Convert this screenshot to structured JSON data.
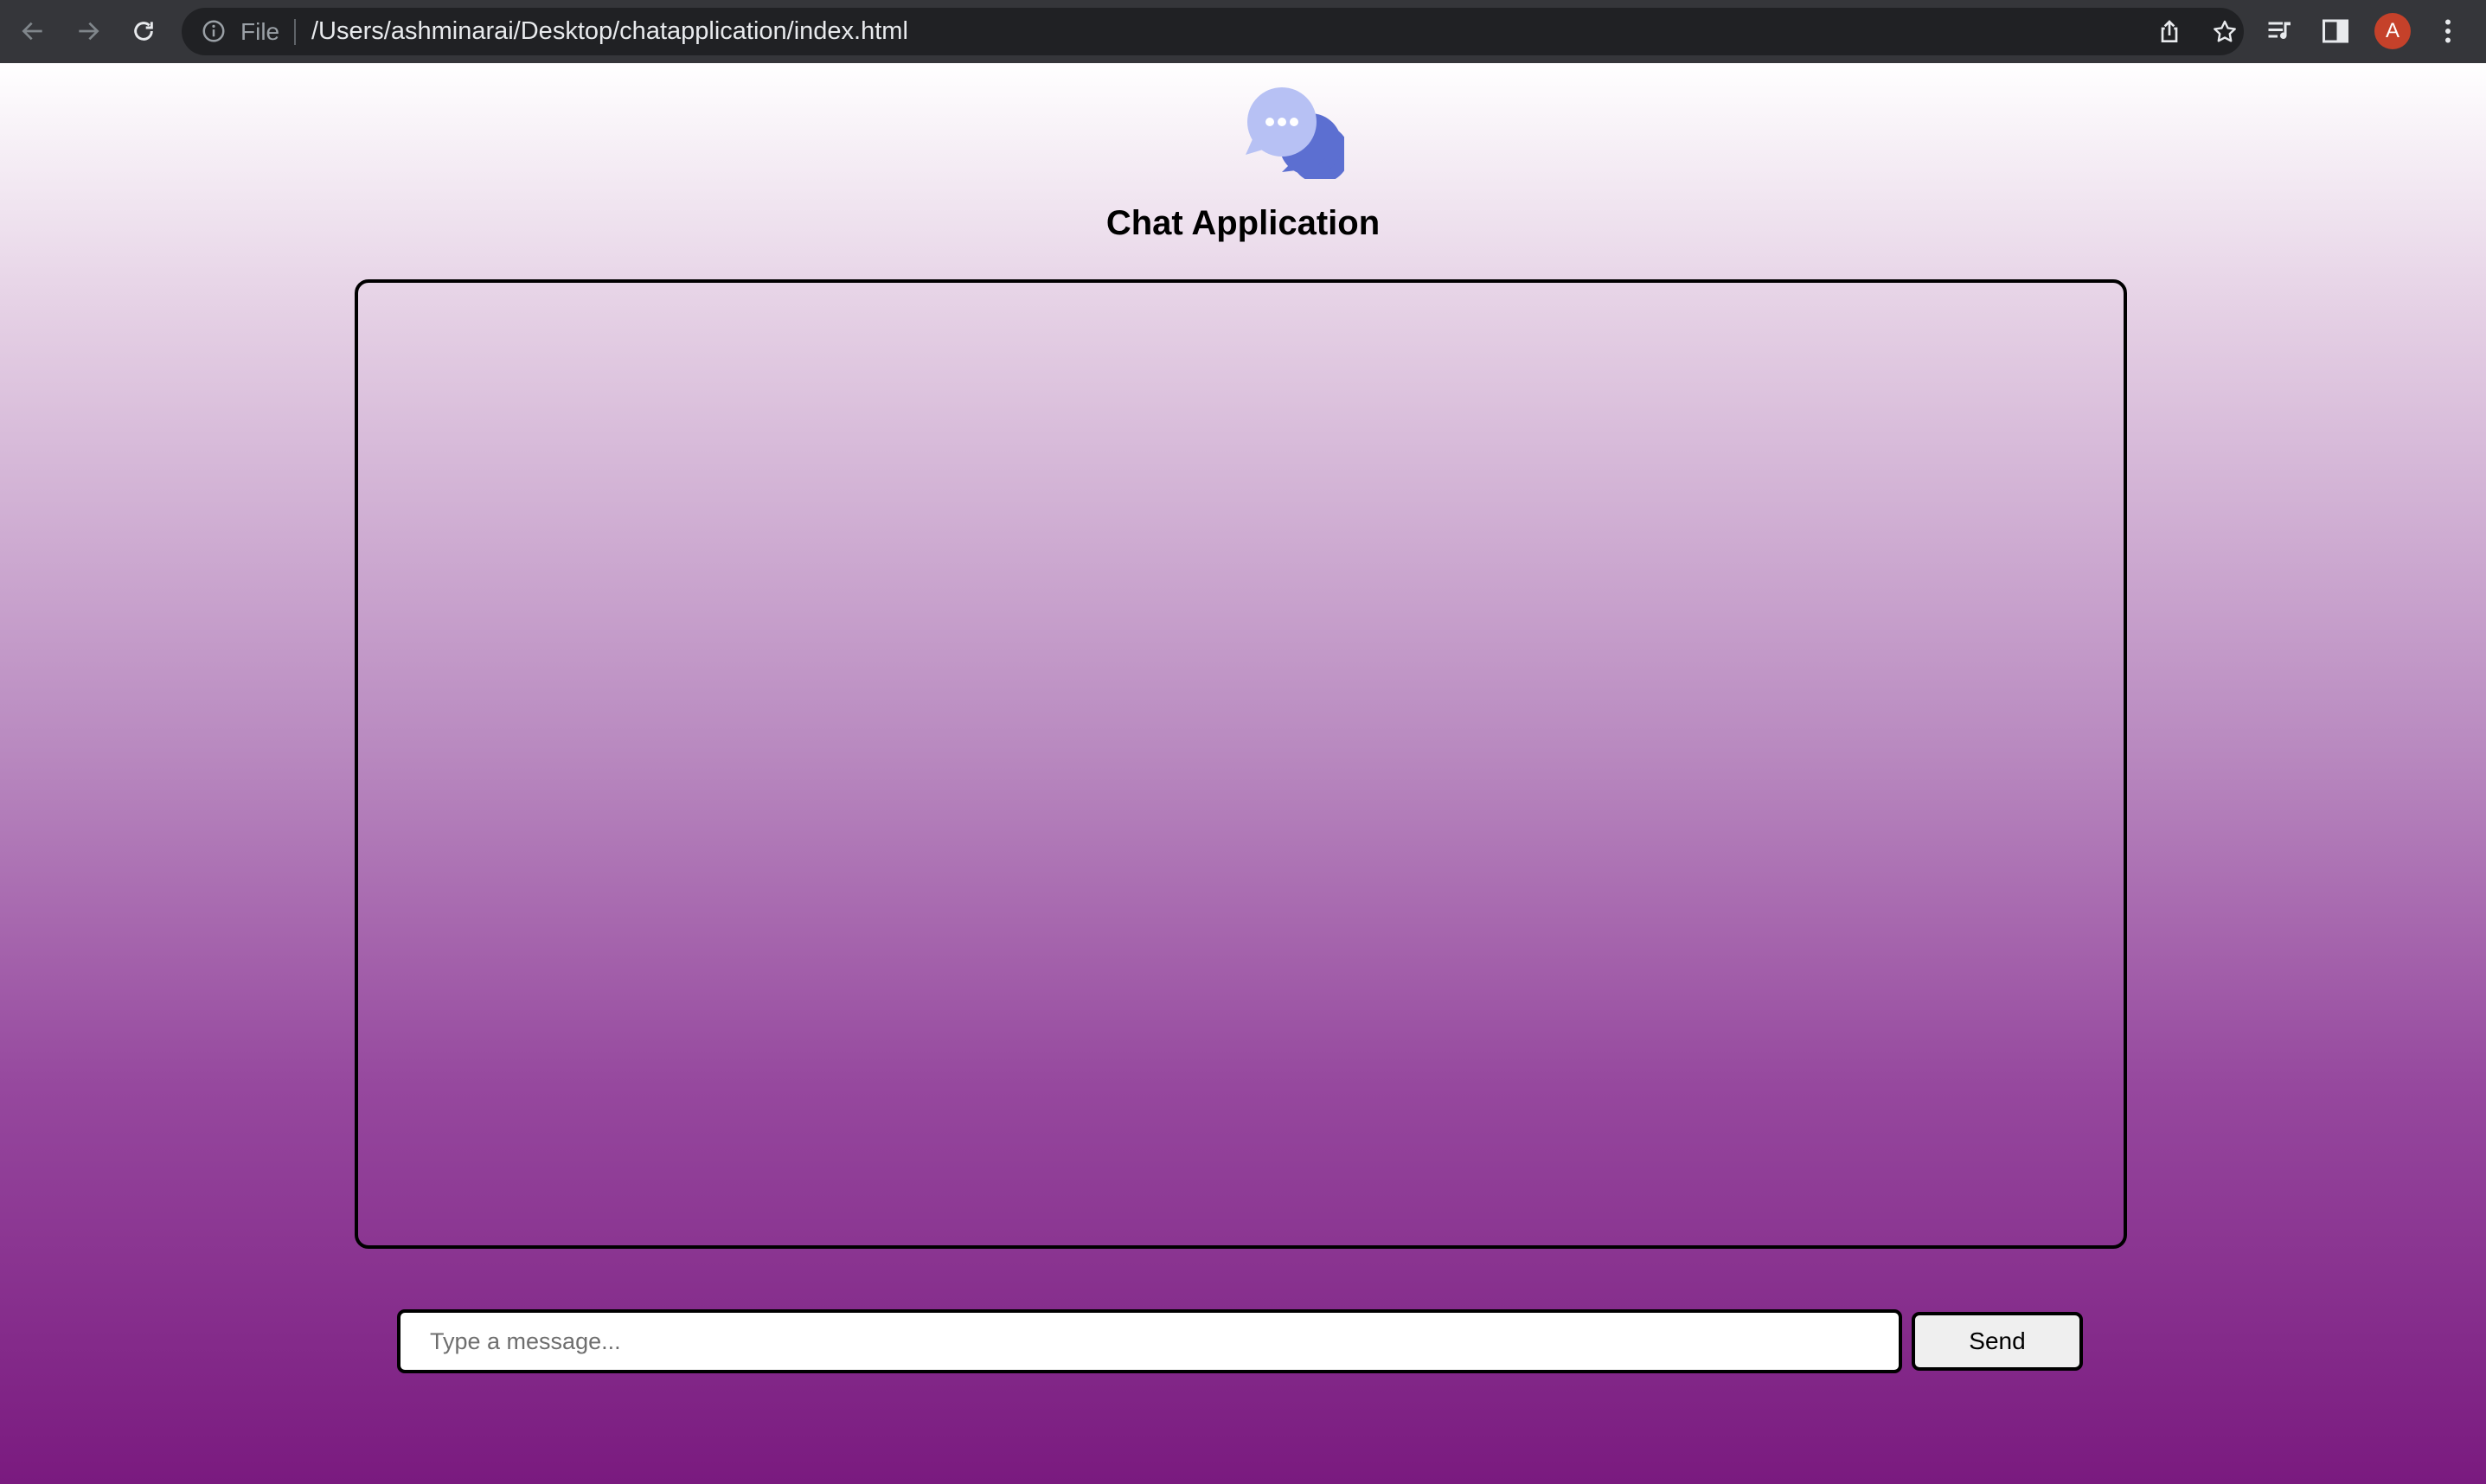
{
  "browser": {
    "nav": {
      "back_icon": "arrow-left-icon",
      "forward_icon": "arrow-right-icon",
      "reload_icon": "reload-icon"
    },
    "omnibox": {
      "info_icon": "info-circle-icon",
      "scheme_label": "File",
      "url": "/Users/ashminarai/Desktop/chatapplication/index.html",
      "share_icon": "share-icon",
      "bookmark_icon": "star-icon"
    },
    "toolbar": {
      "media_icon": "media-queue-icon",
      "side_panel_icon": "side-panel-icon",
      "profile_initial": "A",
      "menu_icon": "kebab-menu-icon"
    },
    "colors": {
      "chrome_bg": "#35363a",
      "omnibox_bg": "#202124",
      "avatar_bg": "#c5412a"
    }
  },
  "page": {
    "logo_icon": "chat-bubbles-icon",
    "title": "Chat Application",
    "chat_box": {
      "messages": []
    },
    "composer": {
      "placeholder": "Type a message...",
      "value": "",
      "send_label": "Send"
    },
    "colors": {
      "gradient_top": "#ffffff",
      "gradient_bottom": "#7a1a7f",
      "logo_front": "#b7c1f4",
      "logo_back": "#5c6fd1",
      "border": "#000000",
      "send_bg": "#efefef"
    }
  }
}
